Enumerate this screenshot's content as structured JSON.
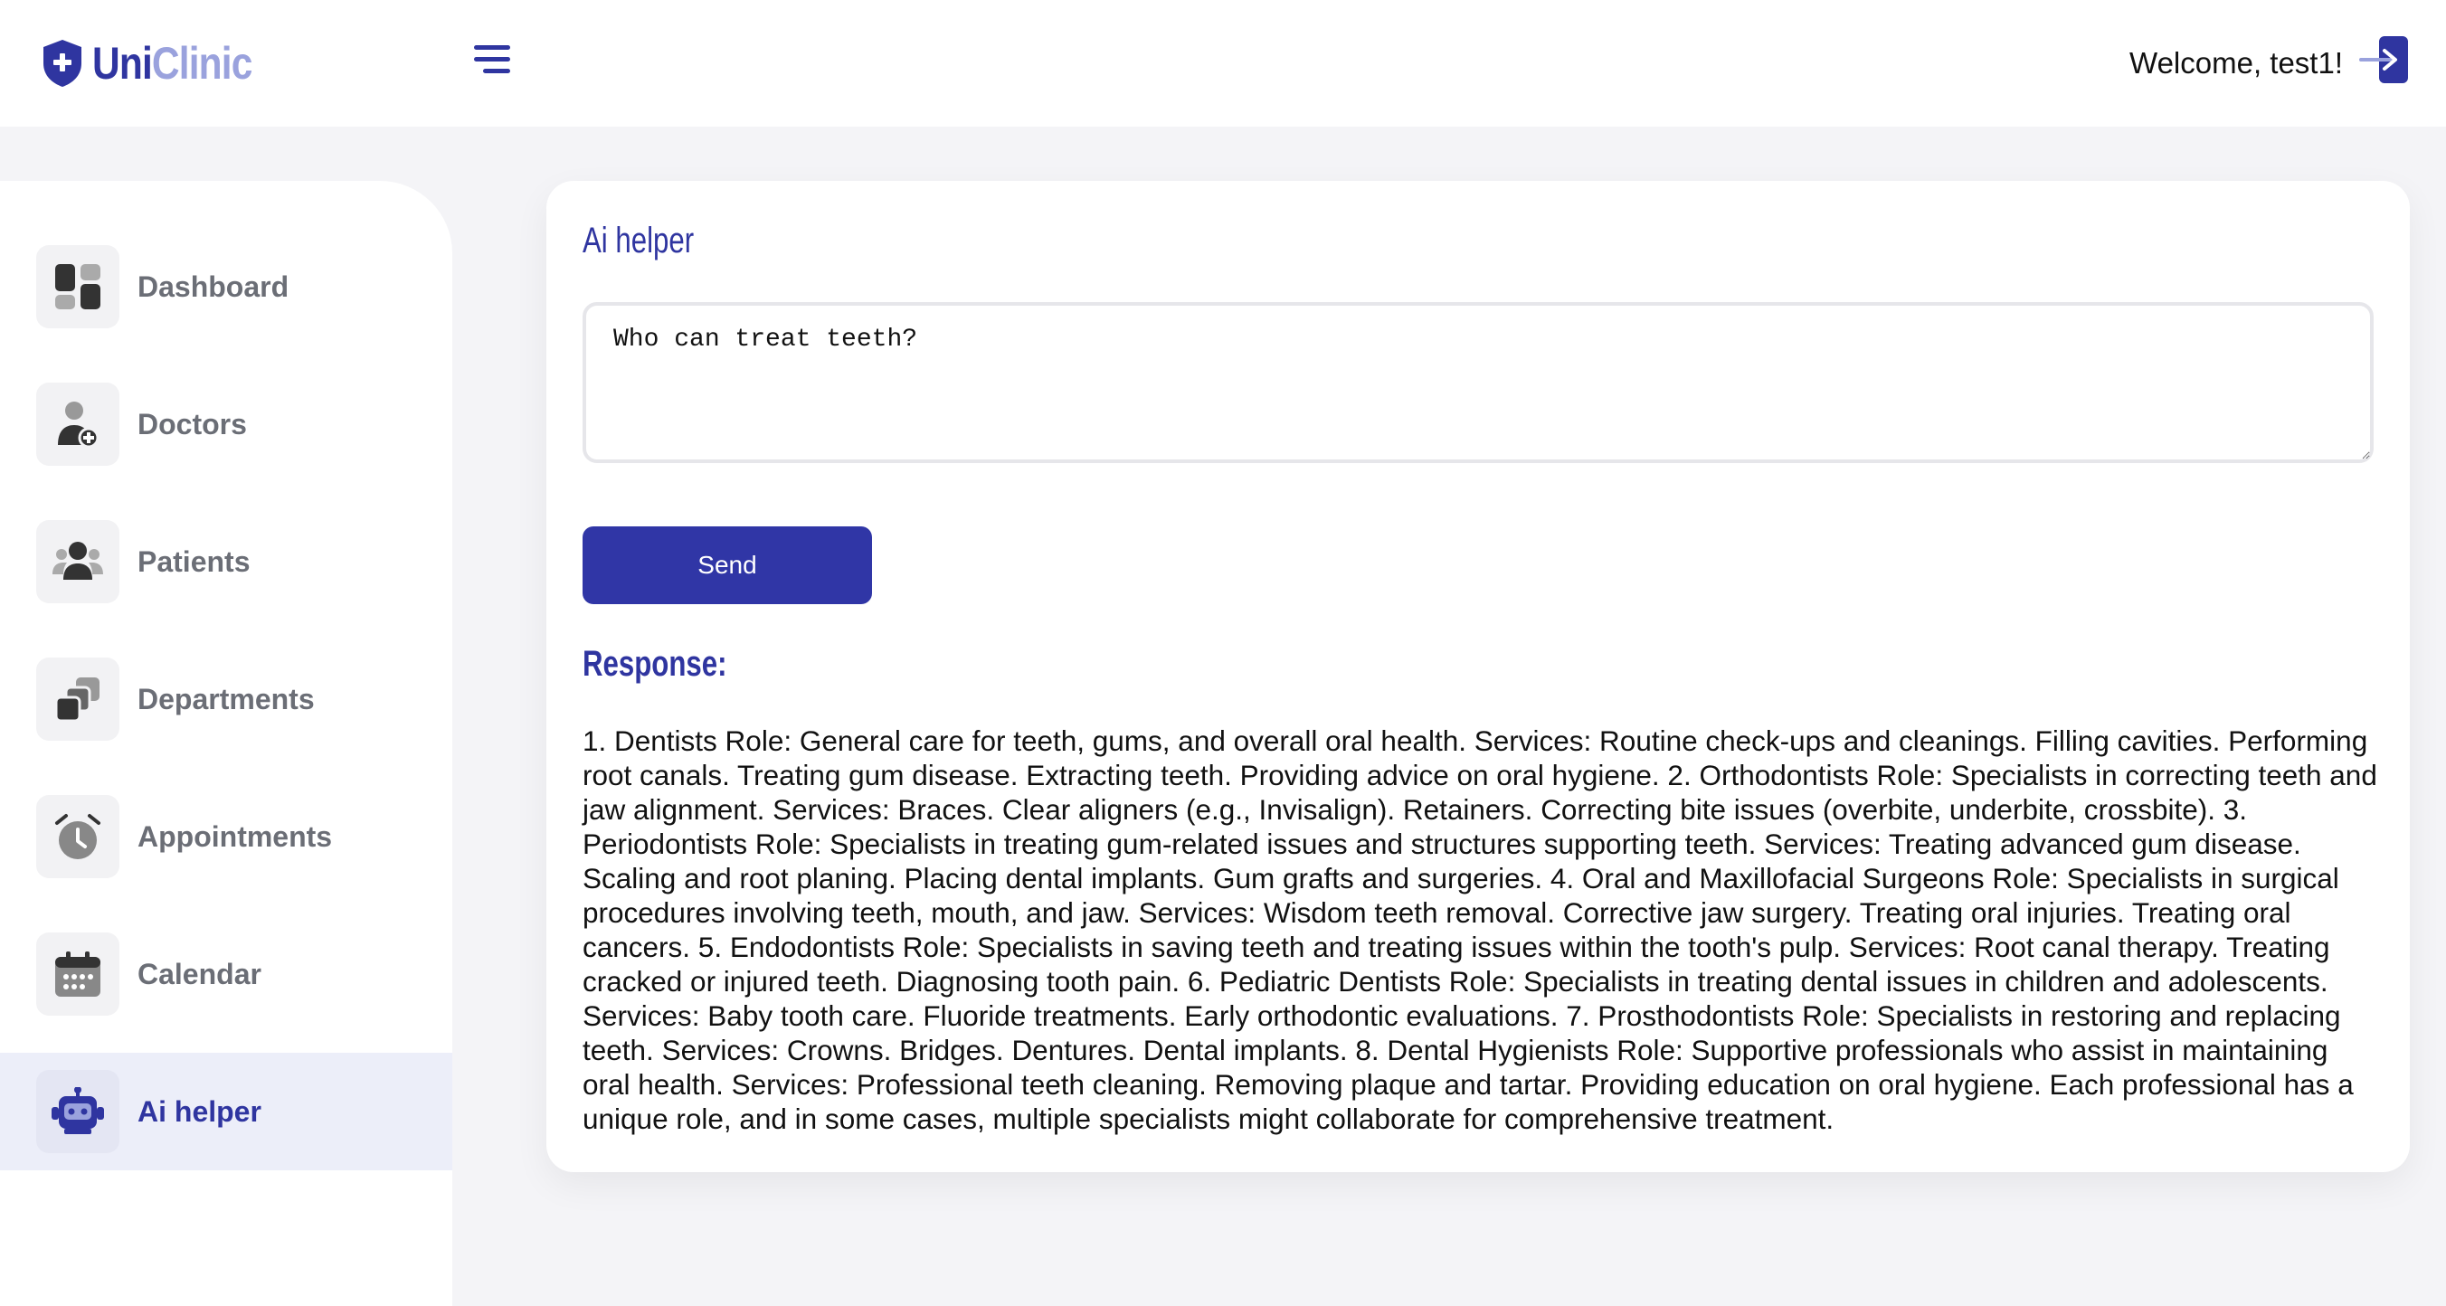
{
  "header": {
    "logo_part1": "Uni",
    "logo_part2": "Clinic",
    "welcome": "Welcome, test1!",
    "menu_icon": "hamburger-icon",
    "logout_icon": "logout-icon"
  },
  "sidebar": {
    "items": [
      {
        "label": "Dashboard",
        "icon": "dashboard-icon",
        "active": false
      },
      {
        "label": "Doctors",
        "icon": "doctor-icon",
        "active": false
      },
      {
        "label": "Patients",
        "icon": "patients-icon",
        "active": false
      },
      {
        "label": "Departments",
        "icon": "departments-icon",
        "active": false
      },
      {
        "label": "Appointments",
        "icon": "alarm-clock-icon",
        "active": false
      },
      {
        "label": "Calendar",
        "icon": "calendar-icon",
        "active": false
      },
      {
        "label": "Ai helper",
        "icon": "robot-icon",
        "active": true
      }
    ]
  },
  "main": {
    "title": "Ai helper",
    "prompt_value": "Who can treat teeth?",
    "send_label": "Send",
    "response_title": "Response:",
    "response_text": "1. Dentists Role: General care for teeth, gums, and overall oral health. Services: Routine check-ups and cleanings. Filling cavities. Performing root canals. Treating gum disease. Extracting teeth. Providing advice on oral hygiene. 2. Orthodontists Role: Specialists in correcting teeth and jaw alignment. Services: Braces. Clear aligners (e.g., Invisalign). Retainers. Correcting bite issues (overbite, underbite, crossbite). 3. Periodontists Role: Specialists in treating gum-related issues and structures supporting teeth. Services: Treating advanced gum disease. Scaling and root planing. Placing dental implants. Gum grafts and surgeries. 4. Oral and Maxillofacial Surgeons Role: Specialists in surgical procedures involving teeth, mouth, and jaw. Services: Wisdom teeth removal. Corrective jaw surgery. Treating oral injuries. Treating oral cancers. 5. Endodontists Role: Specialists in saving teeth and treating issues within the tooth's pulp. Services: Root canal therapy. Treating cracked or injured teeth. Diagnosing tooth pain. 6. Pediatric Dentists Role: Specialists in treating dental issues in children and adolescents. Services: Baby tooth care. Fluoride treatments. Early orthodontic evaluations. 7. Prosthodontists Role: Specialists in restoring and replacing teeth. Services: Crowns. Bridges. Dentures. Dental implants. 8. Dental Hygienists Role: Supportive professionals who assist in maintaining oral health. Services: Professional teeth cleaning. Removing plaque and tartar. Providing education on oral hygiene. Each professional has a unique role, and in some cases, multiple specialists might collaborate for comprehensive treatment."
  },
  "colors": {
    "primary": "#2f35a0",
    "primary_light": "#9aa2dd",
    "active_bg": "#eceef9",
    "page_bg": "#f4f4f7"
  }
}
